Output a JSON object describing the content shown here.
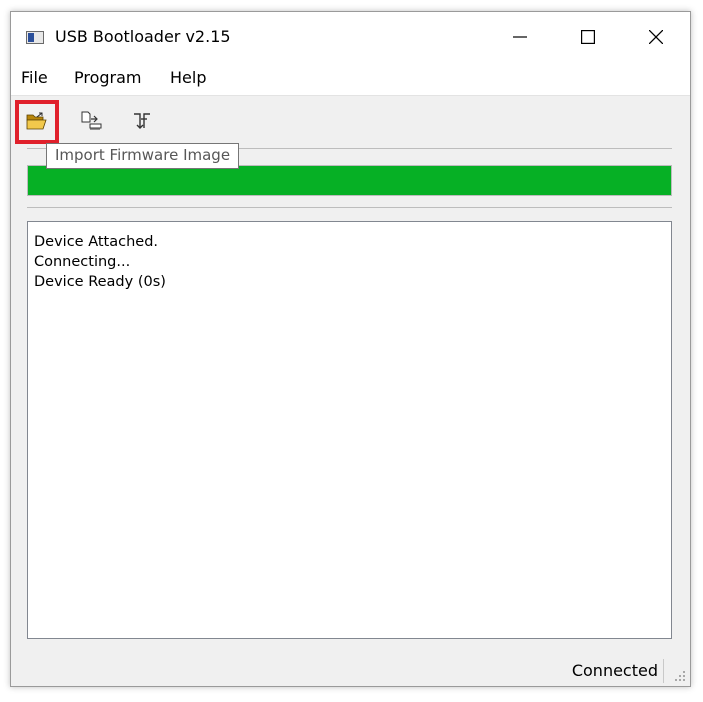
{
  "window": {
    "title": "USB Bootloader v2.15",
    "controls": {
      "minimize_icon": "minimize-icon",
      "maximize_icon": "maximize-icon",
      "close_icon": "close-icon"
    }
  },
  "menu": {
    "items": [
      {
        "label": "File"
      },
      {
        "label": "Program"
      },
      {
        "label": "Help"
      }
    ]
  },
  "toolbar": {
    "buttons": [
      {
        "icon": "open-folder-icon",
        "highlighted": true
      },
      {
        "icon": "program-device-icon"
      },
      {
        "icon": "reset-device-icon"
      }
    ],
    "tooltip": "Import Firmware Image"
  },
  "progress": {
    "value": 1.0,
    "color": "#06b025"
  },
  "log": {
    "lines": [
      "Device Attached.",
      "Connecting...",
      "Device Ready (0s)"
    ]
  },
  "status": {
    "text": "Connected"
  },
  "colors": {
    "highlight": "#e0202b",
    "progress": "#06b025"
  }
}
